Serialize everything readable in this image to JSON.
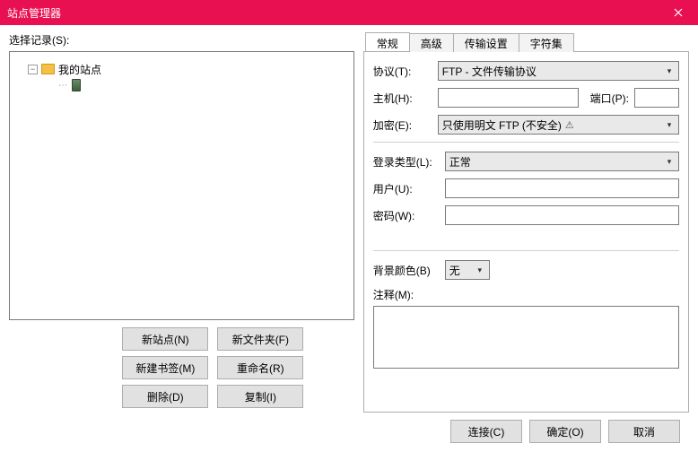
{
  "window": {
    "title": "站点管理器"
  },
  "left": {
    "select_label": "选择记录(S):",
    "root_label": "我的站点",
    "buttons": {
      "new_site": "新站点(N)",
      "new_folder": "新文件夹(F)",
      "new_bookmark": "新建书签(M)",
      "rename": "重命名(R)",
      "delete": "删除(D)",
      "copy": "复制(I)"
    }
  },
  "tabs": {
    "general": "常规",
    "advanced": "高级",
    "transfer": "传输设置",
    "charset": "字符集"
  },
  "form": {
    "protocol_label": "协议(T):",
    "protocol_value": "FTP - 文件传输协议",
    "host_label": "主机(H):",
    "host_value": "",
    "port_label": "端口(P):",
    "port_value": "",
    "encryption_label": "加密(E):",
    "encryption_value": "只使用明文 FTP (不安全)",
    "logon_type_label": "登录类型(L):",
    "logon_type_value": "正常",
    "user_label": "用户(U):",
    "user_value": "",
    "password_label": "密码(W):",
    "password_value": "",
    "bgcolor_label": "背景颜色(B)",
    "bgcolor_value": "无",
    "comment_label": "注释(M):",
    "comment_value": ""
  },
  "bottom": {
    "connect": "连接(C)",
    "ok": "确定(O)",
    "cancel": "取消"
  }
}
